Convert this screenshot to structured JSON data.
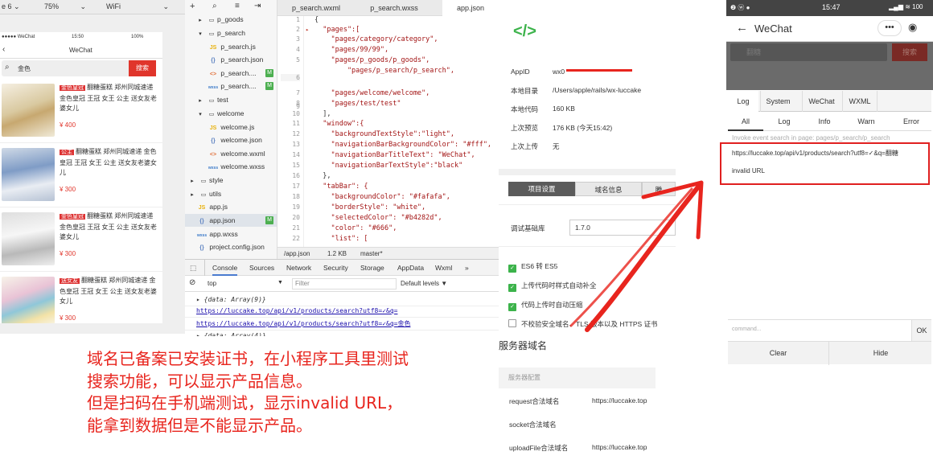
{
  "simulator": {
    "topbar": {
      "device": "e 6",
      "zoom": "75%",
      "network": "WiFi"
    },
    "status": {
      "carrier": "●●●●● WeChat",
      "time": "15:50",
      "battery": "100%"
    },
    "nav_title": "WeChat",
    "search_value": "金色",
    "search_button": "搜索",
    "products": [
      {
        "tag": "金色皇冠",
        "text": "翻糖蛋糕 郑州同城速递 金色皇冠 王冠 女王 公主 送女友老婆女儿",
        "price": "¥ 400"
      },
      {
        "tag": "公主",
        "text": "翻糖蛋糕 郑州同城速递 金色皇冠 王冠 女王 公主 送女友老婆女儿",
        "price": "¥ 300"
      },
      {
        "tag": "金色皇冠",
        "text": "翻糖蛋糕 郑州同城速递 金色皇冠 王冠 女王 公主 送女友老婆女儿",
        "price": "¥ 300"
      },
      {
        "tag": "送女友",
        "text": "翻糖蛋糕 郑州同城速递 金色皇冠 王冠 女王 公主 送女友老婆女儿",
        "price": "¥ 300"
      }
    ]
  },
  "filetree": {
    "items": [
      {
        "label": "p_goods",
        "type": "folder",
        "expanded": false
      },
      {
        "label": "p_search",
        "type": "folder",
        "expanded": true
      },
      {
        "label": "p_search.js",
        "type": "js"
      },
      {
        "label": "p_search.json",
        "type": "json"
      },
      {
        "label": "p_search....",
        "type": "wxml",
        "badge": "M"
      },
      {
        "label": "p_search....",
        "type": "wxss",
        "badge": "M"
      },
      {
        "label": "test",
        "type": "folder",
        "expanded": false
      },
      {
        "label": "welcome",
        "type": "folder",
        "expanded": true
      },
      {
        "label": "welcome.js",
        "type": "js"
      },
      {
        "label": "welcome.json",
        "type": "json"
      },
      {
        "label": "welcome.wxml",
        "type": "wxml"
      },
      {
        "label": "welcome.wxss",
        "type": "wxss"
      },
      {
        "label": "style",
        "type": "folder",
        "expanded": false
      },
      {
        "label": "utils",
        "type": "folder",
        "expanded": false
      },
      {
        "label": "app.js",
        "type": "js"
      },
      {
        "label": "app.json",
        "type": "json",
        "badge": "M"
      },
      {
        "label": "app.wxss",
        "type": "wxss"
      },
      {
        "label": "project.config.json",
        "type": "json"
      }
    ]
  },
  "editor": {
    "tabs": [
      "p_search.wxml",
      "p_search.wxss",
      "app.json"
    ],
    "active_tab": "app.json",
    "lines": [
      {
        "n": "1",
        "code": "{"
      },
      {
        "n": "2",
        "code": "  \"pages\":["
      },
      {
        "n": "3",
        "code": "    \"pages/category/category\","
      },
      {
        "n": "4",
        "code": "    \"pages/99/99\","
      },
      {
        "n": "5",
        "code": "    \"pages/p_goods/p_goods\","
      },
      {
        "n": "",
        "code": "        \"pages/p_search/p_search\","
      },
      {
        "n": "6",
        "code": ""
      },
      {
        "n": "7",
        "code": "    \"pages/welcome/welcome\","
      },
      {
        "n": "8",
        "code": "    \"pages/test/test\""
      },
      {
        "n": "9",
        "code": ""
      },
      {
        "n": "10",
        "code": "  ],"
      },
      {
        "n": "11",
        "code": "  \"window\":{"
      },
      {
        "n": "12",
        "code": "    \"backgroundTextStyle\":\"light\","
      },
      {
        "n": "13",
        "code": "    \"navigationBarBackgroundColor\": \"#fff\","
      },
      {
        "n": "14",
        "code": "    \"navigationBarTitleText\": \"WeChat\","
      },
      {
        "n": "15",
        "code": "    \"navigationBarTextStyle\":\"black\""
      },
      {
        "n": "16",
        "code": "  },"
      },
      {
        "n": "17",
        "code": "  \"tabBar\": {"
      },
      {
        "n": "18",
        "code": "    \"backgroundColor\": \"#fafafa\","
      },
      {
        "n": "19",
        "code": "    \"borderStyle\": \"white\","
      },
      {
        "n": "20",
        "code": "    \"selectedColor\": \"#b4282d\","
      },
      {
        "n": "21",
        "code": "    \"color\": \"#666\","
      },
      {
        "n": "22",
        "code": "    \"list\": ["
      }
    ],
    "status": {
      "path": "/app.json",
      "size": "1.2 KB",
      "branch": "master*"
    }
  },
  "devtools": {
    "tabs": [
      "Console",
      "Sources",
      "Network",
      "Security",
      "Storage",
      "AppData",
      "Wxml",
      "»"
    ],
    "context": "top",
    "filter_placeholder": "Filter",
    "levels": "Default levels ▼",
    "lines": [
      "▸ {data: Array(9)}",
      "https://luccake.top/api/v1/products/search?utf8=✓&q=",
      "https://luccake.top/api/v1/products/search?utf8=✓&q=金色",
      "▸ {data: Array(4)}"
    ]
  },
  "project": {
    "logo": "</>",
    "rows": [
      {
        "label": "AppID",
        "value": "wx0"
      },
      {
        "label": "本地目录",
        "value": "/Users/apple/rails/wx-luccake"
      },
      {
        "label": "本地代码",
        "value": "160 KB"
      },
      {
        "label": "上次预览",
        "value": "176 KB (今天15:42)"
      },
      {
        "label": "上次上传",
        "value": "无"
      }
    ],
    "tabs": [
      "项目设置",
      "域名信息",
      "腾"
    ],
    "base_lib_label": "调试基础库",
    "base_lib_value": "1.7.0",
    "options": [
      {
        "label": "ES6 转 ES5",
        "checked": true
      },
      {
        "label": "上传代码时样式自动补全",
        "checked": true
      },
      {
        "label": "代码上传时自动压缩",
        "checked": true
      },
      {
        "label": "不校验安全域名、TLS 版本以及 HTTPS 证书",
        "checked": false
      }
    ]
  },
  "server": {
    "title": "服务器域名",
    "section": "服务器配置",
    "rows": [
      {
        "label": "request合法域名",
        "value": "https://luccake.top"
      },
      {
        "label": "socket合法域名",
        "value": ""
      },
      {
        "label": "uploadFile合法域名",
        "value": "https://luccake.top"
      }
    ]
  },
  "phone": {
    "status": {
      "left": "❷ ⓦ ●",
      "time": "15:47",
      "right": "▂▄▆ ≋ 100"
    },
    "title": "WeChat",
    "search_value": "翻糖",
    "search_button": "搜索",
    "tabs": [
      "Log",
      "System",
      "WeChat",
      "WXML"
    ],
    "subtabs": [
      "All",
      "Log",
      "Info",
      "Warn",
      "Error"
    ],
    "invoke": "Invoke event search in page: pages/p_search/p_search",
    "log_url": "https://luccake.top/api/v1/products/search?utf8=✓&q=翻糖",
    "log_error": "invalid URL",
    "cmd_placeholder": "command...",
    "ok": "OK",
    "clear": "Clear",
    "hide": "Hide"
  },
  "annotation": {
    "lines": [
      "域名已备案已安装证书，在小程序工具里测试",
      "搜索功能，可以显示产品信息。",
      "但是扫码在手机端测试，显示invalid URL，",
      "能拿到数据但是不能显示产品。"
    ]
  },
  "colors": {
    "accent_red": "#e8251e",
    "wechat_green": "#3cb34b"
  }
}
